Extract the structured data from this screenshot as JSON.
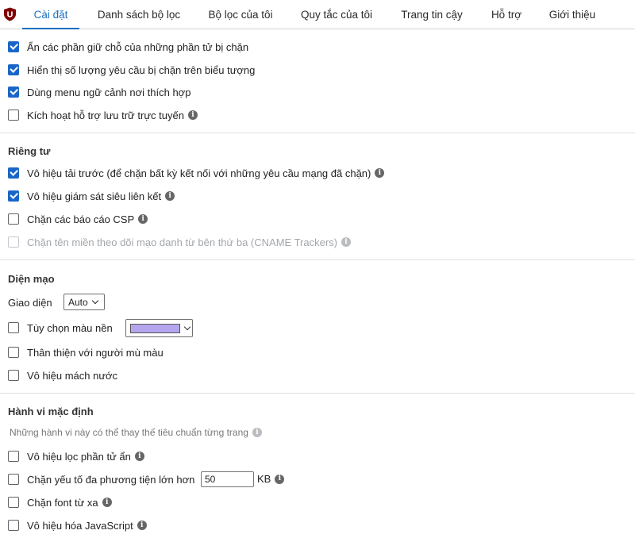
{
  "tabs": [
    "Cài đặt",
    "Danh sách bộ lọc",
    "Bộ lọc của tôi",
    "Quy tắc của tôi",
    "Trang tin cậy",
    "Hỗ trợ",
    "Giới thiệu"
  ],
  "general": {
    "hide_placeholders": {
      "label": "Ẩn các phần giữ chỗ của những phần tử bị chặn",
      "checked": true
    },
    "show_count": {
      "label": "Hiển thị số lượng yêu cầu bị chặn trên biểu tượng",
      "checked": true
    },
    "context_menu": {
      "label": "Dùng menu ngữ cảnh nơi thích hợp",
      "checked": true
    },
    "cloud_storage": {
      "label": "Kích hoạt hỗ trợ lưu trữ trực tuyến",
      "checked": false
    }
  },
  "privacy": {
    "title": "Riêng tư",
    "prefetch": {
      "label": "Vô hiệu tải trước (để chặn bất kỳ kết nối với những yêu cầu mạng đã chặn)",
      "checked": true
    },
    "hyperlink": {
      "label": "Vô hiệu giám sát siêu liên kết",
      "checked": true
    },
    "csp": {
      "label": "Chặn các báo cáo CSP",
      "checked": false
    },
    "cname": {
      "label": "Chặn tên miền theo dõi mạo danh từ bên thứ ba (CNAME Trackers)",
      "checked": false
    }
  },
  "appearance": {
    "title": "Diện mạo",
    "theme_label": "Giao diện",
    "theme_value": "Auto",
    "custom_bg": {
      "label": "Tùy chọn màu nền",
      "checked": false
    },
    "swatch_color": "#b4a5ee",
    "colorblind": {
      "label": "Thân thiện với người mù màu",
      "checked": false
    },
    "tooltips": {
      "label": "Vô hiệu mách nước",
      "checked": false
    }
  },
  "defaults": {
    "title": "Hành vi mặc định",
    "note": "Những hành vi này có thể thay thế tiêu chuẩn từng trang",
    "cosmetic": {
      "label": "Vô hiệu lọc phần tử ẩn",
      "checked": false
    },
    "large_media": {
      "label": "Chặn yếu tố đa phương tiện lớn hơn",
      "checked": false
    },
    "large_media_value": "50",
    "large_media_unit": "KB",
    "remote_fonts": {
      "label": "Chặn font từ xa",
      "checked": false
    },
    "javascript": {
      "label": "Vô hiệu hóa JavaScript",
      "checked": false
    }
  },
  "info_glyph": "i",
  "accent_color": "#1a66c8"
}
